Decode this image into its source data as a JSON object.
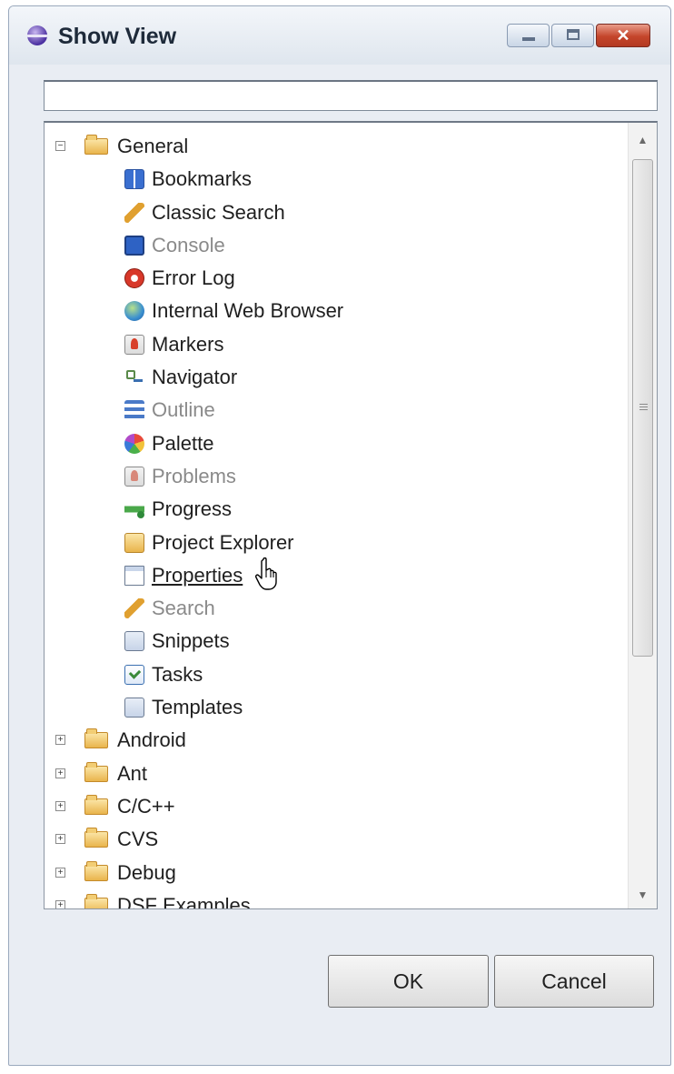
{
  "window": {
    "title": "Show View",
    "controls": [
      "minimize-icon",
      "maximize-icon",
      "close-icon"
    ]
  },
  "filter": {
    "value": "",
    "placeholder": ""
  },
  "tree": {
    "general": {
      "label": "General",
      "expanded": true,
      "children": [
        {
          "label": "Bookmarks",
          "icon": "bookmarks-icon",
          "enabled": true
        },
        {
          "label": "Classic Search",
          "icon": "search-icon",
          "enabled": true
        },
        {
          "label": "Console",
          "icon": "console-icon",
          "enabled": false
        },
        {
          "label": "Error Log",
          "icon": "error-log-icon",
          "enabled": true
        },
        {
          "label": "Internal Web Browser",
          "icon": "globe-icon",
          "enabled": true
        },
        {
          "label": "Markers",
          "icon": "markers-icon",
          "enabled": true
        },
        {
          "label": "Navigator",
          "icon": "navigator-icon",
          "enabled": true
        },
        {
          "label": "Outline",
          "icon": "outline-icon",
          "enabled": false
        },
        {
          "label": "Palette",
          "icon": "palette-icon",
          "enabled": true
        },
        {
          "label": "Problems",
          "icon": "problems-icon",
          "enabled": false
        },
        {
          "label": "Progress",
          "icon": "progress-icon",
          "enabled": true
        },
        {
          "label": "Project Explorer",
          "icon": "project-explorer-icon",
          "enabled": true
        },
        {
          "label": "Properties",
          "icon": "properties-icon",
          "enabled": true,
          "hovered": true
        },
        {
          "label": "Search",
          "icon": "search-icon",
          "enabled": false
        },
        {
          "label": "Snippets",
          "icon": "snippets-icon",
          "enabled": true
        },
        {
          "label": "Tasks",
          "icon": "tasks-icon",
          "enabled": true
        },
        {
          "label": "Templates",
          "icon": "templates-icon",
          "enabled": true
        }
      ]
    },
    "categories": [
      {
        "label": "Android",
        "expanded": false
      },
      {
        "label": "Ant",
        "expanded": false
      },
      {
        "label": "C/C++",
        "expanded": false
      },
      {
        "label": "CVS",
        "expanded": false
      },
      {
        "label": "Debug",
        "expanded": false
      },
      {
        "label": "DSF Examples",
        "expanded": false
      }
    ]
  },
  "buttons": {
    "ok": "OK",
    "cancel": "Cancel"
  },
  "colors": {
    "folder": "#e9b44c",
    "disabled_text": "#8a8a8a",
    "close_button": "#c4452b"
  }
}
